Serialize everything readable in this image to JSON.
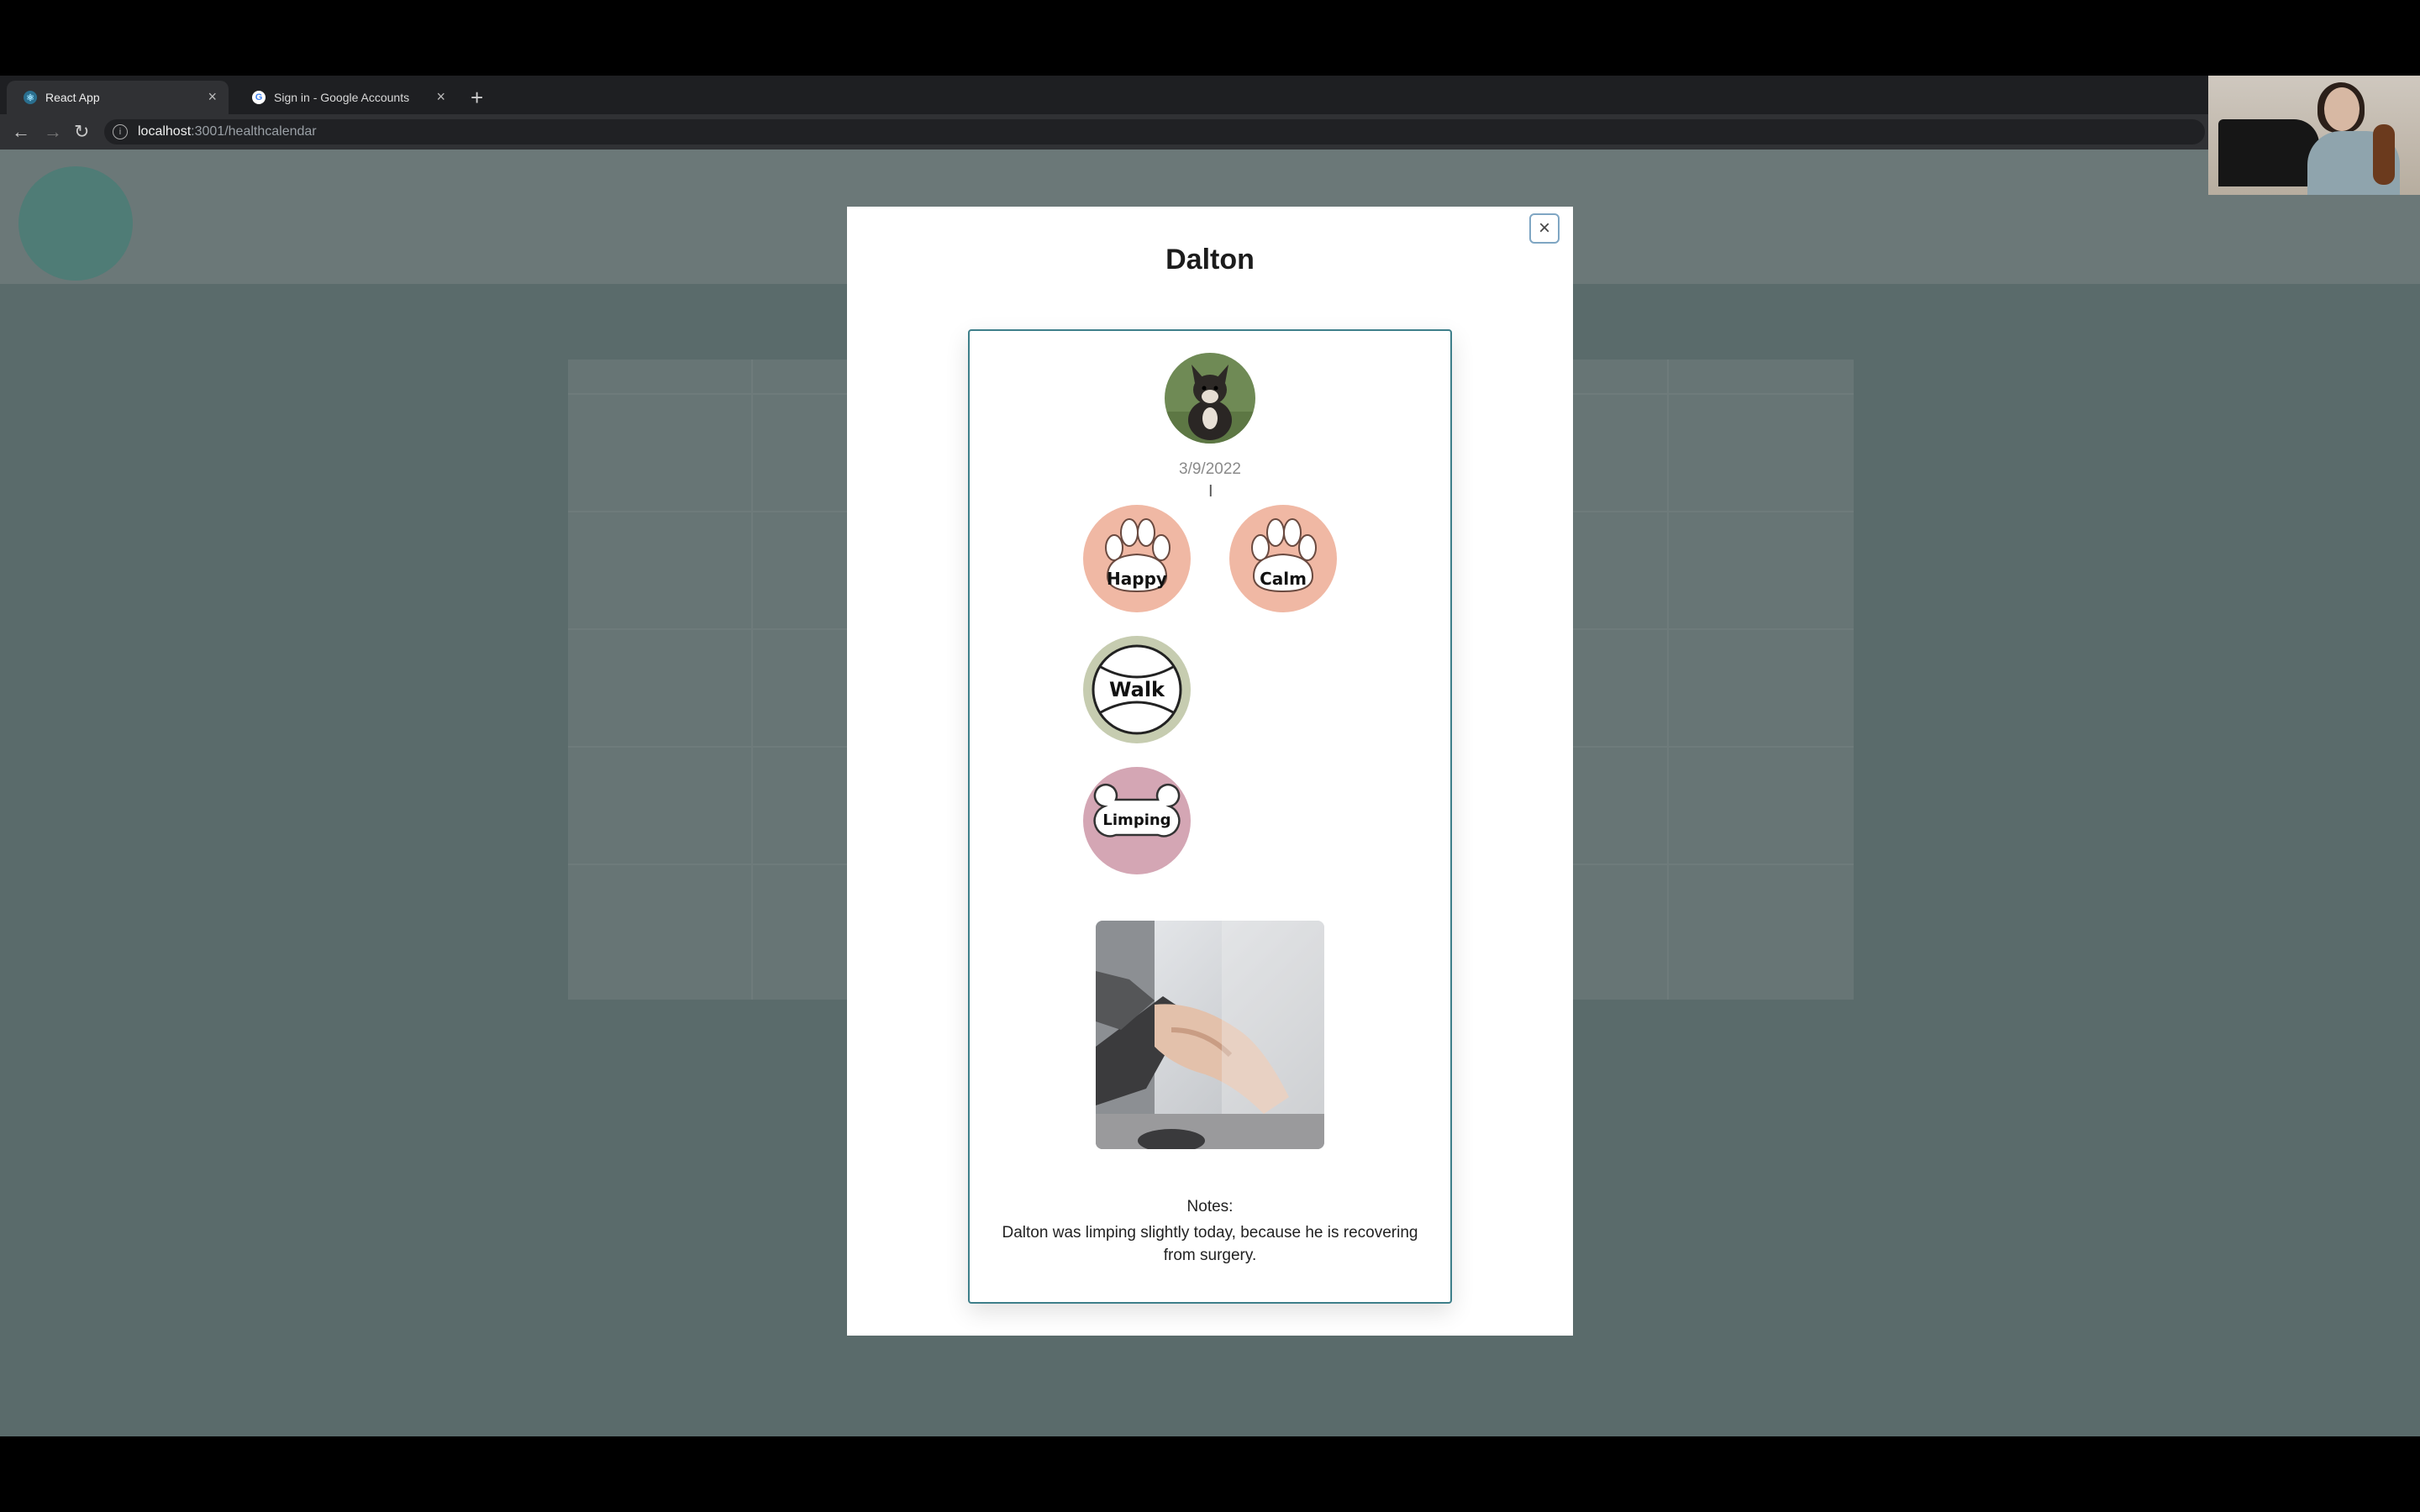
{
  "browser": {
    "tabs": [
      {
        "title": "React App",
        "active": true
      },
      {
        "title": "Sign in - Google Accounts",
        "active": false
      }
    ],
    "url_host": "localhost",
    "url_path": ":3001/healthcalendar"
  },
  "modal": {
    "title": "Dalton",
    "close_icon": "×",
    "entry": {
      "date": "3/9/2022",
      "badges": [
        {
          "label": "Happy",
          "icon": "paw-icon",
          "color": "#f0b8a4"
        },
        {
          "label": "Calm",
          "icon": "paw-icon",
          "color": "#f0b8a4"
        },
        {
          "label": "Walk",
          "icon": "tennis-ball-icon",
          "color": "#c6ccb0"
        },
        {
          "label": "Limping",
          "icon": "bone-icon",
          "color": "#d4a6b4"
        }
      ],
      "notes_label": "Notes:",
      "notes_text": "Dalton was limping slightly today, because he is recovering from surgery."
    }
  },
  "colors": {
    "card_border": "#3e7f8a",
    "close_border": "#7fa6c3"
  }
}
